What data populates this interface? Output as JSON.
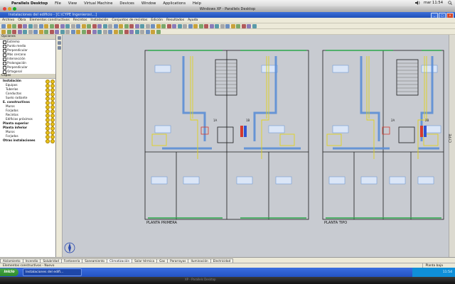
{
  "mac_menubar": {
    "apple": "",
    "app_name": "Parallels Desktop",
    "items": [
      "File",
      "View",
      "Virtual Machine",
      "Devices",
      "Window",
      "Applications",
      "Help"
    ],
    "clock": "mar 11:54",
    "volume_icon": "speaker-icon",
    "search_icon": "spotlight-icon"
  },
  "vm_window": {
    "title": "Windows XP - Parallels Desktop"
  },
  "xp_window": {
    "title": "Instalaciones del edificio - [C:\\CYPE Ingenieros\\...]",
    "min": "_",
    "max": "□",
    "close": "×"
  },
  "app_menu": {
    "items": [
      "Archivo",
      "Obra",
      "Elementos constructivos",
      "Recintos",
      "Instalación",
      "Conjuntos de recintos",
      "Edición",
      "Resultados",
      "Ayuda"
    ]
  },
  "left_panel": {
    "section1_title": "Opciones",
    "snap_items": [
      {
        "label": "Extremo",
        "checked": true
      },
      {
        "label": "Punto medio",
        "checked": false
      },
      {
        "label": "Perpendicular",
        "checked": false
      },
      {
        "label": "Más cercano",
        "checked": true
      },
      {
        "label": "Intersección",
        "checked": true
      },
      {
        "label": "Prolongación",
        "checked": false
      },
      {
        "label": "Perpendicular",
        "checked": false
      },
      {
        "label": "Ortogonal",
        "checked": false
      }
    ],
    "section2_title": "Capas",
    "layers": [
      {
        "label": "Instalación",
        "bold": true,
        "indent": false
      },
      {
        "label": "Equipos",
        "bold": false,
        "indent": true
      },
      {
        "label": "Tuberías",
        "bold": false,
        "indent": true
      },
      {
        "label": "Conductos",
        "bold": false,
        "indent": true
      },
      {
        "label": "Suelo radiante",
        "bold": false,
        "indent": true
      },
      {
        "label": "E. constructivos",
        "bold": true,
        "indent": false
      },
      {
        "label": "Muros",
        "bold": false,
        "indent": true
      },
      {
        "label": "Forjados",
        "bold": false,
        "indent": true
      },
      {
        "label": "Recintos",
        "bold": false,
        "indent": true
      },
      {
        "label": "Edificios próximos",
        "bold": false,
        "indent": true
      },
      {
        "label": "Planta superior",
        "bold": true,
        "indent": false
      },
      {
        "label": "Planta inferior",
        "bold": true,
        "indent": false
      },
      {
        "label": "Muros",
        "bold": false,
        "indent": true
      },
      {
        "label": "Forjados",
        "bold": false,
        "indent": true
      },
      {
        "label": "Otras instalaciones",
        "bold": true,
        "indent": false
      }
    ]
  },
  "drawing": {
    "plan_left_label": "PLANTA PRIMERA",
    "plan_right_label": "PLANTA TIPO",
    "room_tags": [
      "1A",
      "1B",
      "2A",
      "2B"
    ],
    "side_brand": "CYPE",
    "line_color": "#1b1b1b",
    "duct_color": "#5c8fd6",
    "pipe_color": "#e0d21c",
    "accent_color": "#2aa84a"
  },
  "bottom_tabs": [
    {
      "label": "Aislamiento",
      "active": false
    },
    {
      "label": "Incendio",
      "active": false
    },
    {
      "label": "Salubridad",
      "active": false
    },
    {
      "label": "Fontanería",
      "active": false
    },
    {
      "label": "Saneamiento",
      "active": false
    },
    {
      "label": "Climatización",
      "active": true
    },
    {
      "label": "Solar térmica",
      "active": false
    },
    {
      "label": "Gas",
      "active": false
    },
    {
      "label": "Pararrayos",
      "active": false
    },
    {
      "label": "Iluminación",
      "active": false
    },
    {
      "label": "Electricidad",
      "active": false
    }
  ],
  "status_bar": {
    "message": "Elementos constructivos - Nuevo",
    "floor": "Planta baja"
  },
  "taskbar": {
    "start": "inicio",
    "task": "Instalaciones del edifi...",
    "tray_time": "11:54"
  },
  "dock": {
    "label": "XP - Parallels Desktop"
  }
}
